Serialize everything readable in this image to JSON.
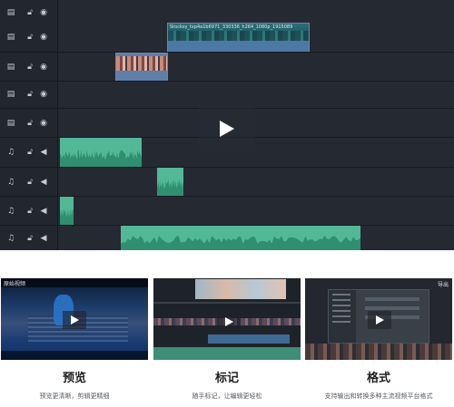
{
  "timeline": {
    "clip_label": "Stocksy_txp4a1b6971_330336_h264_1080p_1915089",
    "tracks": [
      {
        "type": "video",
        "icons": [
          "film-icon",
          "lock-icon",
          "eye-icon"
        ]
      },
      {
        "type": "video",
        "icons": [
          "film-icon",
          "lock-icon",
          "eye-icon"
        ]
      },
      {
        "type": "video",
        "icons": [
          "film-icon",
          "lock-icon",
          "eye-icon"
        ]
      },
      {
        "type": "video",
        "icons": [
          "film-icon",
          "lock-icon",
          "eye-icon"
        ]
      },
      {
        "type": "video",
        "icons": [
          "film-icon",
          "lock-icon",
          "eye-icon"
        ]
      },
      {
        "type": "audio",
        "icons": [
          "music-note-icon",
          "lock-icon",
          "speaker-icon"
        ]
      },
      {
        "type": "audio",
        "icons": [
          "music-note-icon",
          "lock-icon",
          "speaker-icon"
        ]
      },
      {
        "type": "audio",
        "icons": [
          "music-note-icon",
          "lock-icon",
          "speaker-icon"
        ]
      },
      {
        "type": "audio",
        "icons": [
          "music-note-icon",
          "lock-icon",
          "speaker-icon"
        ]
      }
    ]
  },
  "features": [
    {
      "title": "预览",
      "desc": "预览更清晰，剪辑更精细",
      "badge": "原始视频"
    },
    {
      "title": "标记",
      "desc": "随手标记，让编辑更轻松"
    },
    {
      "title": "格式",
      "desc": "支持输出和转换多种主流视频平台格式",
      "badge": "导出"
    }
  ],
  "colors": {
    "editor_bg": "#1c2027",
    "audio_clip": "#52b895",
    "video_clip": "#1f4a5a"
  }
}
